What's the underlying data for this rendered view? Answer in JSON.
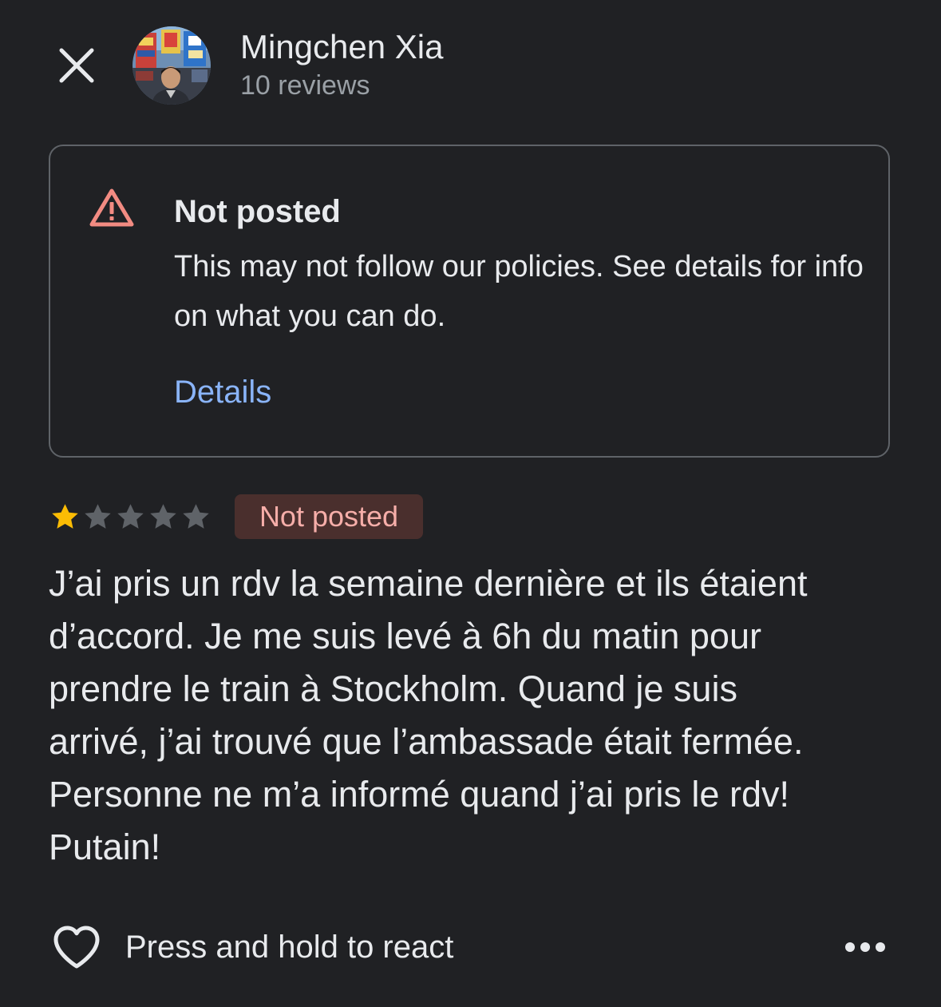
{
  "header": {
    "close_icon": "close-icon",
    "avatar_icon": "avatar",
    "user_name": "Mingchen Xia",
    "review_count": "10 reviews"
  },
  "notice": {
    "icon": "warning-icon",
    "icon_color": "#f28b82",
    "title": "Not posted",
    "body": "This may not follow our policies. See details for info on what you can do.",
    "details_label": "Details",
    "link_color": "#8ab4f8"
  },
  "review": {
    "rating": 1,
    "rating_max": 5,
    "star_filled_color": "#fbbc04",
    "star_empty_color": "#5f6368",
    "status_label": "Not posted",
    "status_bg": "#4a2f2d",
    "status_text_color": "#f6aea9",
    "text_lines": [
      "J’ai pris un rdv la semaine dernière et ils étaient",
      "d’accord. Je me suis levé à 6h du matin pour",
      "prendre le train à Stockholm. Quand je suis",
      "arrivé, j’ai trouvé que l’ambassade était fermée.",
      "Personne ne m’a informé quand j’ai pris le rdv!",
      "Putain!"
    ]
  },
  "footer": {
    "react_icon": "heart-icon",
    "react_label": "Press and hold to react",
    "more_icon": "more-horizontal-icon"
  }
}
